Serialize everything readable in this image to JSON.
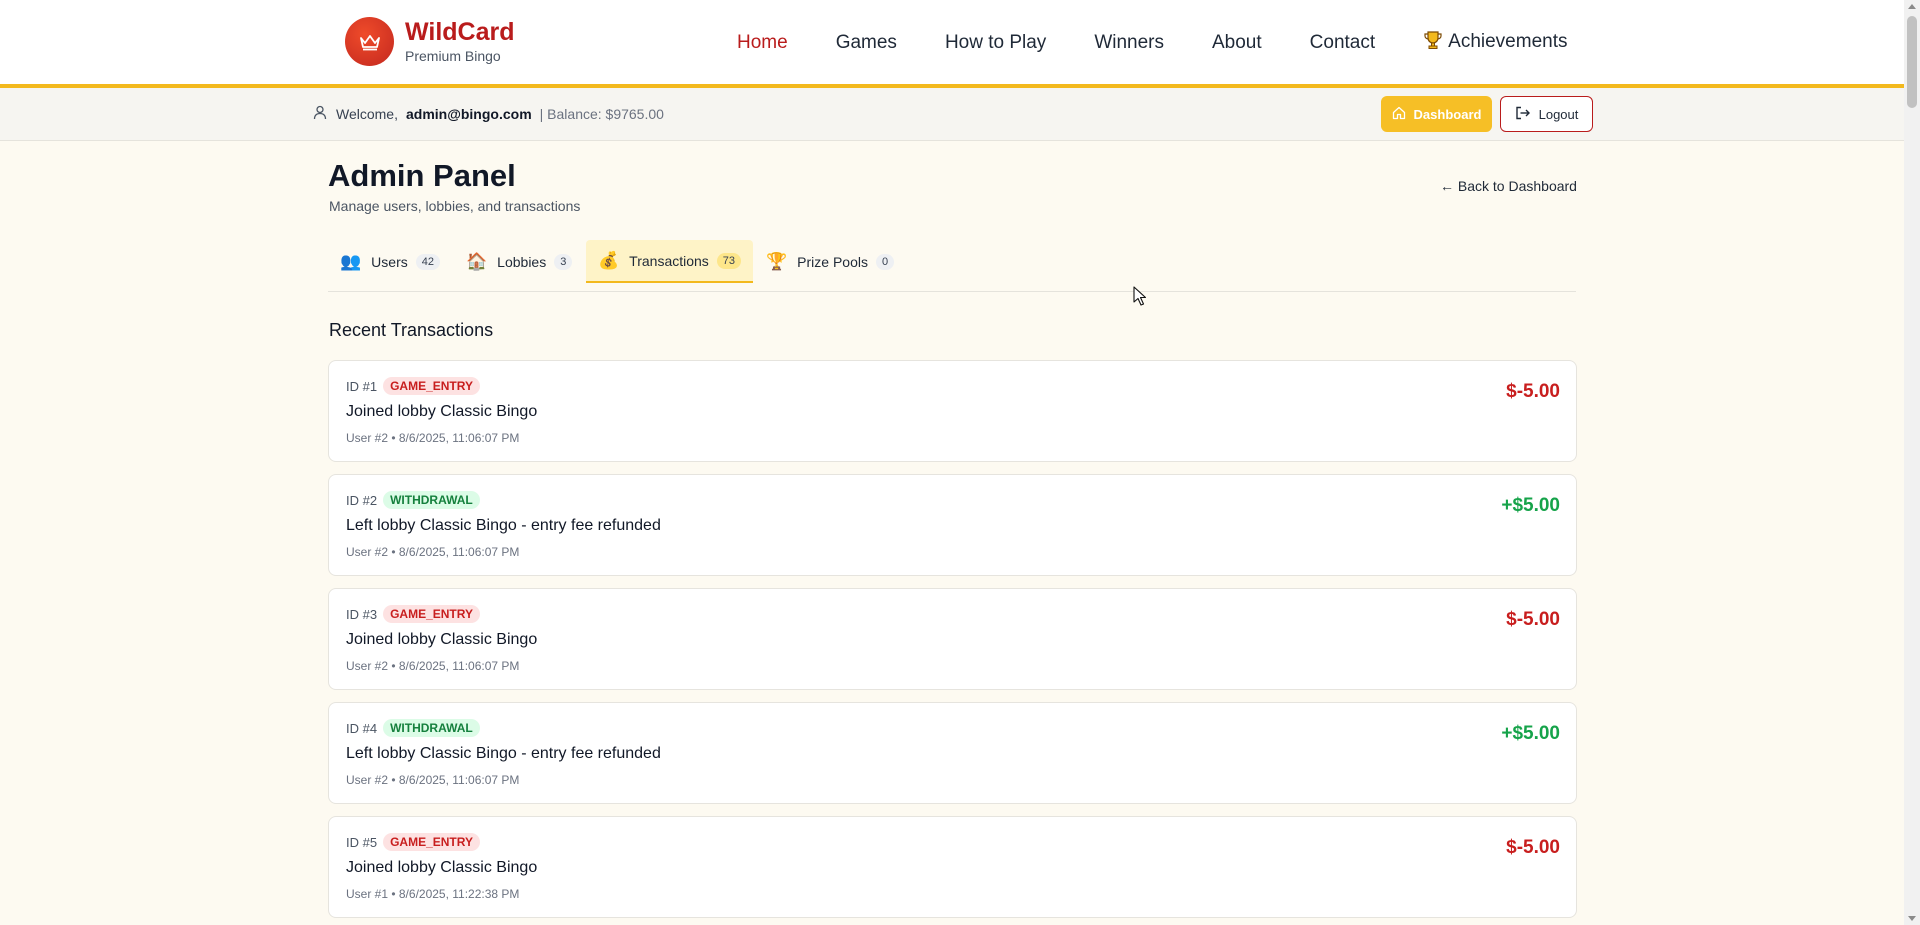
{
  "brand": {
    "name": "WildCard",
    "tagline": "Premium Bingo"
  },
  "nav": {
    "home": "Home",
    "games": "Games",
    "how_to_play": "How to Play",
    "winners": "Winners",
    "about": "About",
    "contact": "Contact",
    "achievements": "Achievements"
  },
  "userbar": {
    "welcome": "Welcome,",
    "email": "admin@bingo.com",
    "balance": "| Balance: $9765.00",
    "dashboard_label": "Dashboard",
    "logout_label": "Logout"
  },
  "page": {
    "title": "Admin Panel",
    "subtitle": "Manage users, lobbies, and transactions",
    "back_link": "← Back to Dashboard"
  },
  "tabs": [
    {
      "icon": "👥",
      "label": "Users",
      "count": "42"
    },
    {
      "icon": "🏠",
      "label": "Lobbies",
      "count": "3"
    },
    {
      "icon": "💰",
      "label": "Transactions",
      "count": "73"
    },
    {
      "icon": "🏆",
      "label": "Prize Pools",
      "count": "0"
    }
  ],
  "section_title": "Recent Transactions",
  "transactions": [
    {
      "id": "ID #1",
      "type": "GAME_ENTRY",
      "description": "Joined lobby Classic Bingo",
      "meta": "User #2 • 8/6/2025, 11:06:07 PM",
      "amount": "$-5.00"
    },
    {
      "id": "ID #2",
      "type": "WITHDRAWAL",
      "description": "Left lobby Classic Bingo - entry fee refunded",
      "meta": "User #2 • 8/6/2025, 11:06:07 PM",
      "amount": "+$5.00"
    },
    {
      "id": "ID #3",
      "type": "GAME_ENTRY",
      "description": "Joined lobby Classic Bingo",
      "meta": "User #2 • 8/6/2025, 11:06:07 PM",
      "amount": "$-5.00"
    },
    {
      "id": "ID #4",
      "type": "WITHDRAWAL",
      "description": "Left lobby Classic Bingo - entry fee refunded",
      "meta": "User #2 • 8/6/2025, 11:06:07 PM",
      "amount": "+$5.00"
    },
    {
      "id": "ID #5",
      "type": "GAME_ENTRY",
      "description": "Joined lobby Classic Bingo",
      "meta": "User #1 • 8/6/2025, 11:22:38 PM",
      "amount": "$-5.00"
    }
  ],
  "colors": {
    "brand_red": "#b91c1c",
    "accent_gold": "#f3b91d",
    "positive": "#16a34a",
    "negative": "#c81e1e"
  }
}
